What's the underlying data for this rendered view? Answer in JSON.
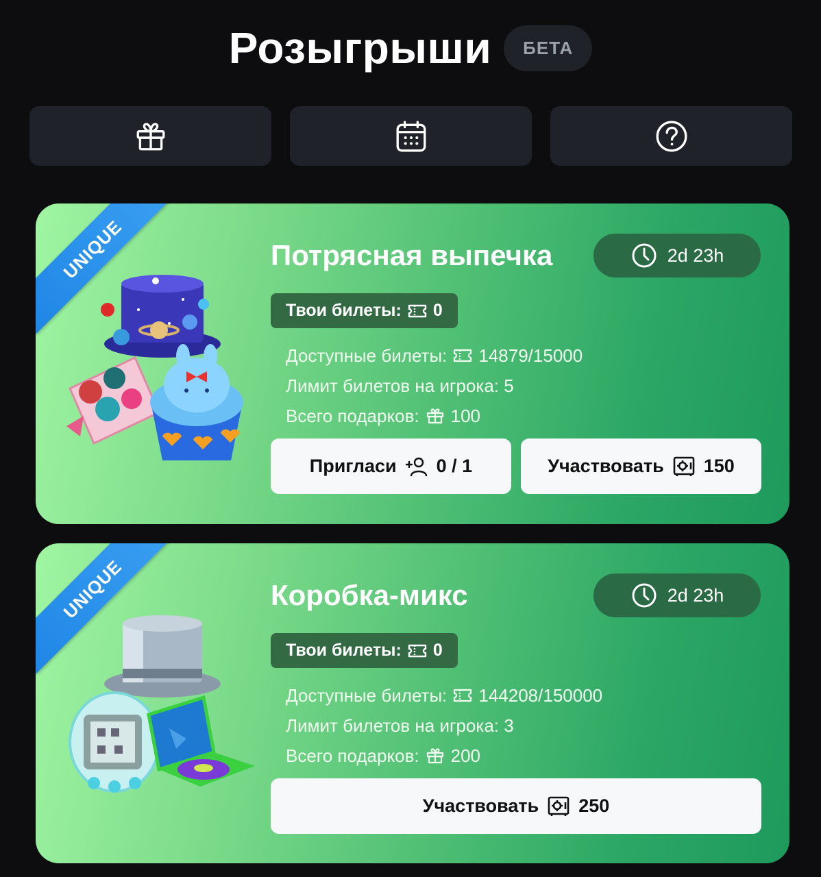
{
  "header": {
    "title": "Розыгрыши",
    "badge": "БЕТА"
  },
  "tabs": [
    {
      "icon": "gift-icon"
    },
    {
      "icon": "calendar-icon"
    },
    {
      "icon": "help-icon"
    }
  ],
  "giveaways": [
    {
      "ribbon": "UNIQUE",
      "title": "Потрясная выпечка",
      "timer": "2d 23h",
      "my_tickets_label": "Твои билеты:",
      "my_tickets_value": "0",
      "available_label": "Доступные билеты:",
      "available_value": "14879/15000",
      "limit_label": "Лимит билетов на игрока: 5",
      "total_gifts_label": "Всего подарков:",
      "total_gifts_value": "100",
      "invite_label": "Пригласи",
      "invite_value": "0 / 1",
      "join_label": "Участвовать",
      "join_cost": "150"
    },
    {
      "ribbon": "UNIQUE",
      "title": "Коробка-микс",
      "timer": "2d 23h",
      "my_tickets_label": "Твои билеты:",
      "my_tickets_value": "0",
      "available_label": "Доступные билеты:",
      "available_value": "144208/150000",
      "limit_label": "Лимит билетов на игрока: 3",
      "total_gifts_label": "Всего подарков:",
      "total_gifts_value": "200",
      "join_label": "Участвовать",
      "join_cost": "250"
    }
  ],
  "colors": {
    "background": "#0d0d0f",
    "tab_bg": "#1f2329",
    "card_gradient_start": "#9ff5a2",
    "card_gradient_end": "#1e9a5c",
    "ribbon": "#2a93ec",
    "timer_bg": "#2a6a45",
    "tickets_bg": "#336a44",
    "button_bg": "#f7f8fa"
  }
}
